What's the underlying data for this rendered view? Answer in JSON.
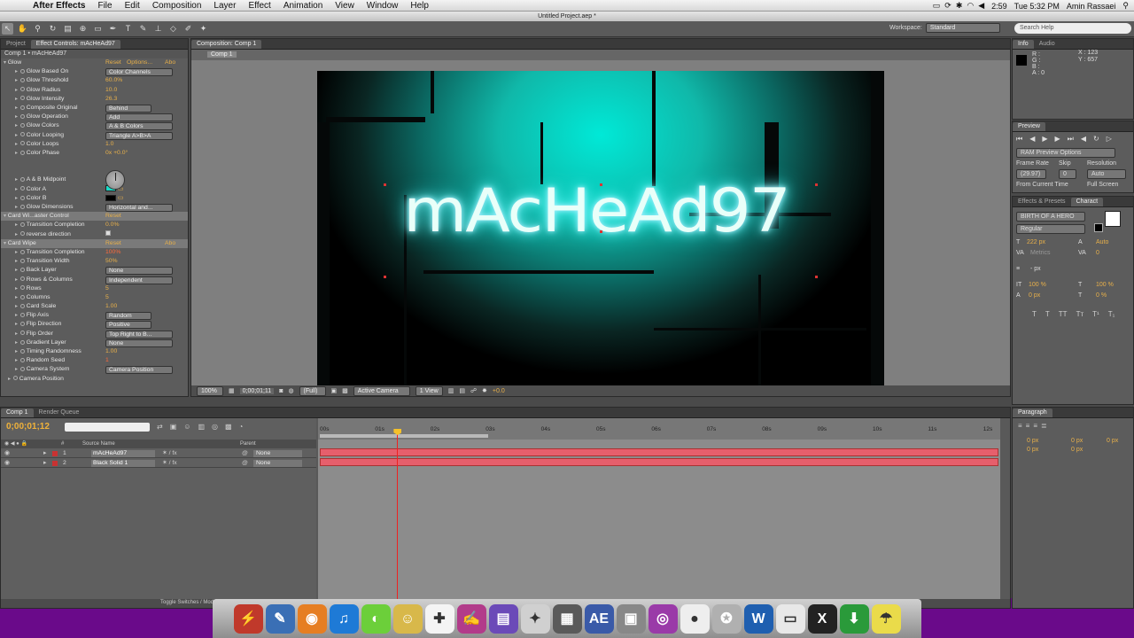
{
  "menubar": {
    "app": "After Effects",
    "items": [
      "File",
      "Edit",
      "Composition",
      "Layer",
      "Effect",
      "Animation",
      "View",
      "Window",
      "Help"
    ],
    "battery": "2:59",
    "clock": "Tue 5:32 PM",
    "user": "Amin Rassaei"
  },
  "window": {
    "title": "Untitled Project.aep *"
  },
  "toolbar": {
    "workspace_label": "Workspace:",
    "workspace_value": "Standard",
    "search_placeholder": "Search Help"
  },
  "fx_panel": {
    "tabs": [
      "Project",
      "Effect Controls: mAcHeAd97"
    ],
    "header": "Comp 1 • mAcHeAd97",
    "rows": [
      {
        "label": "Glow",
        "reset": "Reset",
        "extra": "Options...",
        "extra2": "Abo",
        "kind": "fx"
      },
      {
        "label": "Glow Based On",
        "value": "Color Channels",
        "kind": "dd"
      },
      {
        "label": "Glow Threshold",
        "value": "60.0%",
        "kind": "val"
      },
      {
        "label": "Glow Radius",
        "value": "10.0",
        "kind": "val"
      },
      {
        "label": "Glow Intensity",
        "value": "26.3",
        "kind": "val"
      },
      {
        "label": "Composite Original",
        "value": "Behind",
        "kind": "ddshort"
      },
      {
        "label": "Glow Operation",
        "value": "Add",
        "kind": "dd"
      },
      {
        "label": "Glow Colors",
        "value": "A & B Colors",
        "kind": "dd"
      },
      {
        "label": "Color Looping",
        "value": "Triangle A>B>A",
        "kind": "dd"
      },
      {
        "label": "Color Loops",
        "value": "1.0",
        "kind": "val"
      },
      {
        "label": "Color Phase",
        "value": "0x +0.0°",
        "kind": "val"
      },
      {
        "label": "",
        "value": "",
        "kind": "blank"
      },
      {
        "label": "",
        "value": "",
        "kind": "blank"
      },
      {
        "label": "A & B Midpoint",
        "value": "50%",
        "kind": "val"
      },
      {
        "label": "Color A",
        "value": "",
        "kind": "colorA"
      },
      {
        "label": "Color B",
        "value": "",
        "kind": "colorB"
      },
      {
        "label": "Glow Dimensions",
        "value": "Horizontal and...",
        "kind": "dd"
      },
      {
        "label": "Card Wi...aster Control",
        "reset": "Reset",
        "kind": "fxhl"
      },
      {
        "label": "Transition Completion",
        "value": "0.0%",
        "kind": "val"
      },
      {
        "label": "reverse direction",
        "value": "",
        "kind": "check"
      },
      {
        "label": "Card Wipe",
        "reset": "Reset",
        "extra2": "Abo",
        "kind": "fxhl"
      },
      {
        "label": "Transition Completion",
        "value": "100%",
        "kind": "valred"
      },
      {
        "label": "Transition Width",
        "value": "50%",
        "kind": "val"
      },
      {
        "label": "Back Layer",
        "value": "None",
        "kind": "dd"
      },
      {
        "label": "Rows & Columns",
        "value": "Independent",
        "kind": "dd"
      },
      {
        "label": "Rows",
        "value": "5",
        "kind": "val"
      },
      {
        "label": "Columns",
        "value": "5",
        "kind": "val"
      },
      {
        "label": "Card Scale",
        "value": "1.00",
        "kind": "val"
      },
      {
        "label": "Flip Axis",
        "value": "Random",
        "kind": "ddshort"
      },
      {
        "label": "Flip Direction",
        "value": "Positive",
        "kind": "ddshort"
      },
      {
        "label": "Flip Order",
        "value": "Top Right to B...",
        "kind": "dd"
      },
      {
        "label": "Gradient Layer",
        "value": "None",
        "kind": "dd"
      },
      {
        "label": "Timing Randomness",
        "value": "1.00",
        "kind": "val"
      },
      {
        "label": "Random Seed",
        "value": "1",
        "kind": "valred"
      },
      {
        "label": "Camera System",
        "value": "Camera Position",
        "kind": "dd"
      },
      {
        "label": "Camera Position",
        "value": "",
        "kind": "sub"
      }
    ]
  },
  "comp_panel": {
    "tab": "Composition: Comp 1",
    "crumb": "Comp 1",
    "title_text": "mAcHeAd97",
    "footer": {
      "zoom": "100%",
      "timecode": "0;00;01;11",
      "resolution": "(Full)",
      "camera": "Active Camera",
      "view": "1 View",
      "exposure": "+0.0"
    }
  },
  "info_panel": {
    "tabs": [
      "Info",
      "Audio"
    ],
    "r": "R :",
    "g": "G :",
    "b": "B :",
    "a": "A : 0",
    "x": "X : 123",
    "y": "Y : 657"
  },
  "preview_panel": {
    "tab": "Preview",
    "ram": "RAM Preview Options",
    "fr_label": "Frame Rate",
    "skip_label": "Skip",
    "res_label": "Resolution",
    "fr": "(29.97)",
    "skip": "0",
    "res": "Auto",
    "from_current": "From Current Time",
    "full_screen": "Full Screen"
  },
  "character_panel": {
    "tabs": [
      "Effects & Presets",
      "Charact"
    ],
    "font": "BIRTH OF A HERO",
    "style": "Regular",
    "size": "222 px",
    "leading": "Auto",
    "kerning": "Metrics",
    "tracking": "0",
    "stroke": "- px",
    "vscale": "100 %",
    "hscale": "100 %",
    "baseline": "0 px",
    "tsume": "0 %"
  },
  "timeline": {
    "tabs": [
      "Comp 1",
      "Render Queue"
    ],
    "timecode": "0;00;01;12",
    "col_source": "Source Name",
    "col_parent": "Parent",
    "layers": [
      {
        "num": "1",
        "name": "mAcHeAd97",
        "parent": "None",
        "color": "#c83232"
      },
      {
        "num": "2",
        "name": "Black Solid 1",
        "parent": "None",
        "color": "#c83232"
      }
    ],
    "ticks": [
      "00s",
      "01s",
      "02s",
      "03s",
      "04s",
      "05s",
      "06s",
      "07s",
      "08s",
      "09s",
      "10s",
      "11s",
      "12s"
    ],
    "toggle": "Toggle Switches / Modes",
    "playhead_seconds": 1.4
  },
  "paragraph_panel": {
    "tab": "Paragraph",
    "px": "0 px"
  },
  "dock": {
    "icons": [
      "flash-icon",
      "preview-icon",
      "firefox-icon",
      "itunes-icon",
      "messages-icon",
      "cat-icon",
      "notes-icon",
      "paint-icon",
      "movie-icon",
      "star-icon",
      "clapper-icon",
      "ae-icon",
      "photo-icon",
      "video-icon",
      "robot-icon",
      "warrior-icon",
      "word-icon",
      "folder-icon",
      "bridge-icon",
      "download-icon",
      "trash-icon"
    ],
    "labels": [
      "⚡",
      "✎",
      "◉",
      "♫",
      "◐",
      "☺",
      "✚",
      "✍",
      "▤",
      "✦",
      "▦",
      "AE",
      "▣",
      "◎",
      "●",
      "✪",
      "W",
      "▭",
      "X",
      "⬇",
      "☂"
    ]
  }
}
